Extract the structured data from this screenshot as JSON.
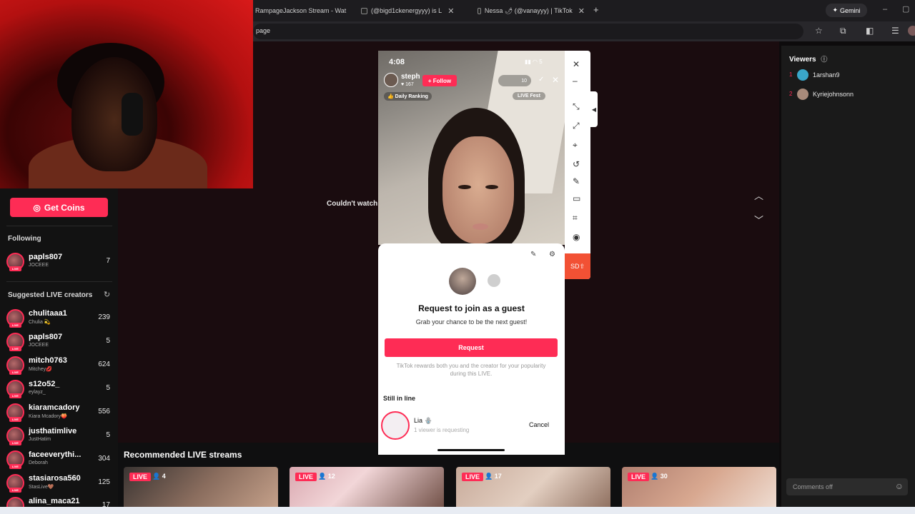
{
  "browser": {
    "tabs": [
      {
        "title": "RampageJackson Stream - Wat"
      },
      {
        "title": "(@bigd1ckenergyyy) is L"
      },
      {
        "title": "Nessa 🌶 (@vanayyy) | TikTok"
      }
    ],
    "new_tab": "+",
    "gemini_label": "Gemini",
    "address_text": "page"
  },
  "sidebar": {
    "get_coins": "Get Coins",
    "following_header": "Following",
    "following": [
      {
        "name": "papls807",
        "sub": "JOCEEE",
        "count": "7"
      }
    ],
    "suggested_header": "Suggested LIVE creators",
    "suggested": [
      {
        "name": "chulitaaa1",
        "sub": "Chulia 💫",
        "count": "239"
      },
      {
        "name": "papls807",
        "sub": "JOCEEE",
        "count": "5"
      },
      {
        "name": "mitch0763",
        "sub": "Mitchey💋",
        "count": "624"
      },
      {
        "name": "s12o52_",
        "sub": "eylayz_",
        "count": "5"
      },
      {
        "name": "kiaramcadory",
        "sub": "Kiara Mcadory🍑",
        "count": "556"
      },
      {
        "name": "justhatimlive",
        "sub": "JustHatim",
        "count": "5"
      },
      {
        "name": "faceeverythi...",
        "sub": "Deborah",
        "count": "304"
      },
      {
        "name": "stasiarosa560",
        "sub": "StasLive🤎",
        "count": "125"
      },
      {
        "name": "alina_maca21",
        "sub": "",
        "count": "17"
      }
    ],
    "live_tag": "LIVE"
  },
  "main": {
    "couldnt_watch": "Couldn't watch"
  },
  "phone": {
    "time": "4:08",
    "status": "5",
    "host_name": "steph",
    "host_likes": "167",
    "follow": "+ Follow",
    "viewer_count": "10",
    "daily_ranking": "👍 Daily Ranking",
    "live_fest": "LIVE Fest"
  },
  "guest_sheet": {
    "title": "Request to join as a guest",
    "subtitle": "Grab your chance to be the next guest!",
    "request_button": "Request",
    "reward_note": "TikTok rewards both you and the creator for your popularity during this LIVE.",
    "still_in_line": "Still in line",
    "queue_name": "Lia 🪬",
    "queue_sub": "1 viewer is requesting",
    "cancel": "Cancel"
  },
  "side_toolbar": {
    "sd_label": "SD"
  },
  "recommended": {
    "title": "Recommended LIVE streams",
    "cards": [
      {
        "badge": "LIVE",
        "viewers": "4"
      },
      {
        "badge": "LIVE",
        "viewers": "12"
      },
      {
        "badge": "LIVE",
        "viewers": "17"
      },
      {
        "badge": "LIVE",
        "viewers": "30"
      }
    ]
  },
  "viewers_panel": {
    "title": "Viewers",
    "list": [
      {
        "rank": "1",
        "name": "1arshan9"
      },
      {
        "rank": "2",
        "name": "Kyriejohnsonn"
      }
    ],
    "comments_placeholder": "Comments off"
  }
}
